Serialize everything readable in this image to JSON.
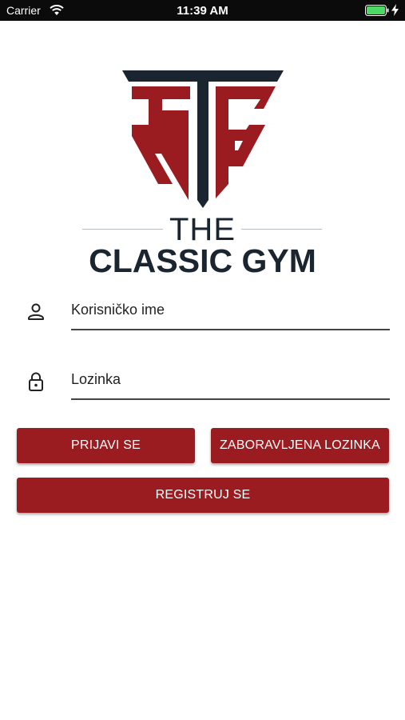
{
  "status_bar": {
    "carrier": "Carrier",
    "time": "11:39 AM",
    "wifi_icon": "wifi-icon",
    "battery_icon": "battery-icon",
    "charging_icon": "charging-bolt-icon"
  },
  "logo": {
    "line1": "THE",
    "line2": "CLASSIC GYM",
    "colors": {
      "dark": "#1a2530",
      "red": "#9b1c20"
    }
  },
  "form": {
    "username": {
      "placeholder": "Korisničko ime",
      "value": "",
      "icon": "user-icon"
    },
    "password": {
      "placeholder": "Lozinka",
      "value": "",
      "icon": "lock-icon"
    }
  },
  "buttons": {
    "login": "PRIJAVI SE",
    "forgot": "ZABORAVLJENA LOZINKA",
    "register": "REGISTRUJ SE"
  },
  "theme": {
    "accent": "#9b1c20",
    "statusbar_bg": "#0b0b0b"
  }
}
